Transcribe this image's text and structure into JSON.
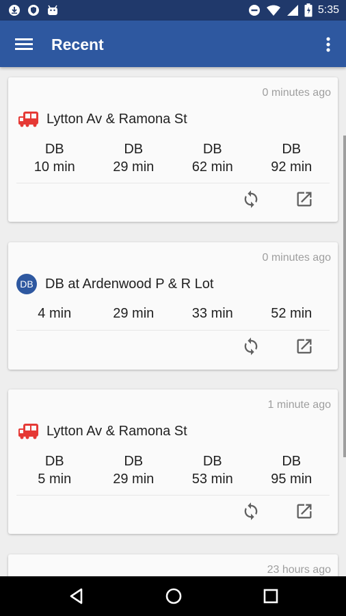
{
  "status_bar": {
    "time": "5:35",
    "left_icons": [
      "download-icon",
      "shield-icon",
      "android-icon"
    ],
    "right_icons": [
      "do-not-disturb-icon",
      "wifi-icon",
      "signal-icon",
      "battery-icon"
    ]
  },
  "app_bar": {
    "title": "Recent"
  },
  "cards": [
    {
      "ago": "0 minutes ago",
      "stop": "Lytton Av & Ramona St",
      "type": "bus",
      "arrivals": [
        {
          "route": "DB",
          "time": "10 min"
        },
        {
          "route": "DB",
          "time": "29 min"
        },
        {
          "route": "DB",
          "time": "62 min"
        },
        {
          "route": "DB",
          "time": "92 min"
        }
      ]
    },
    {
      "ago": "0 minutes ago",
      "stop": "DB at Ardenwood P & R Lot",
      "type": "route",
      "badge": "DB",
      "arrivals": [
        {
          "time": "4 min"
        },
        {
          "time": "29 min"
        },
        {
          "time": "33 min"
        },
        {
          "time": "52 min"
        }
      ]
    },
    {
      "ago": "1 minute ago",
      "stop": "Lytton Av & Ramona St",
      "type": "bus",
      "arrivals": [
        {
          "route": "DB",
          "time": "5 min"
        },
        {
          "route": "DB",
          "time": "29 min"
        },
        {
          "route": "DB",
          "time": "53 min"
        },
        {
          "route": "DB",
          "time": "95 min"
        }
      ]
    },
    {
      "ago": "23 hours ago"
    }
  ],
  "colors": {
    "status_bar": "#20396b",
    "app_bar": "#2e58a0",
    "bus_icon": "#e53935",
    "badge": "#2e58a0"
  }
}
